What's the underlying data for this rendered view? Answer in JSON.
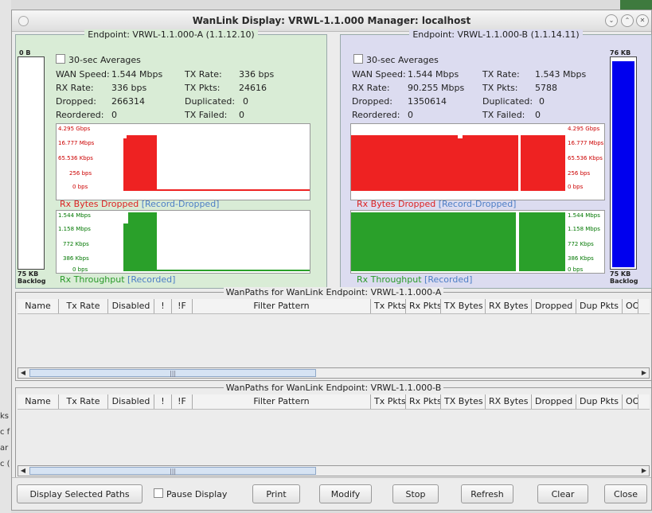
{
  "window": {
    "title": "WanLink Display: VRWL-1.1.000  Manager: localhost"
  },
  "backdrop": {
    "side_labels": [
      "ks",
      "c f",
      "ar",
      "c ("
    ]
  },
  "endpoint_a": {
    "legend": "Endpoint: VRWL-1.1.000-A  (1.1.12.10)",
    "backlog_top": "0 B",
    "backlog_bottom": "75 KB",
    "backlog_caption": "Backlog",
    "backlog_fill_fraction": 0,
    "averages_label": "30-sec Averages",
    "wan_speed_label": "WAN Speed:",
    "wan_speed_value": "1.544 Mbps",
    "tx_rate_label": "TX Rate:",
    "tx_rate_value": "336 bps",
    "rx_rate_label": "RX Rate:",
    "rx_rate_value": "336 bps",
    "tx_pkts_label": "TX Pkts:",
    "tx_pkts_value": "24616",
    "dropped_label": "Dropped:",
    "dropped_value": "266314",
    "duplicated_label": "Duplicated:",
    "duplicated_value": "0",
    "reordered_label": "Reordered:",
    "reordered_value": "0",
    "tx_failed_label": "TX Failed:",
    "tx_failed_value": "0",
    "drop_chart": {
      "title": "Rx Bytes Dropped",
      "subtitle": "[Record-Dropped]",
      "ticks": [
        "4.295 Gbps",
        "16.777 Mbps",
        "65.536 Kbps",
        "256 bps",
        "0 bps"
      ],
      "color": "#ee2222"
    },
    "thru_chart": {
      "title": "Rx Throughput",
      "subtitle": "[Recorded]",
      "ticks": [
        "1.544 Mbps",
        "1.158 Mbps",
        "772 Kbps",
        "386 Kbps",
        "0 bps"
      ],
      "color": "#2aa02a"
    }
  },
  "endpoint_b": {
    "legend": "Endpoint: VRWL-1.1.000-B  (1.1.14.11)",
    "backlog_top": "76 KB",
    "backlog_bottom": "75 KB",
    "backlog_caption": "Backlog",
    "backlog_fill_fraction": 0.99,
    "averages_label": "30-sec Averages",
    "wan_speed_label": "WAN Speed:",
    "wan_speed_value": "1.544 Mbps",
    "tx_rate_label": "TX Rate:",
    "tx_rate_value": "1.543 Mbps",
    "rx_rate_label": "RX Rate:",
    "rx_rate_value": "90.255 Mbps",
    "tx_pkts_label": "TX Pkts:",
    "tx_pkts_value": "5788",
    "dropped_label": "Dropped:",
    "dropped_value": "1350614",
    "duplicated_label": "Duplicated:",
    "duplicated_value": "0",
    "reordered_label": "Reordered:",
    "reordered_value": "0",
    "tx_failed_label": "TX Failed:",
    "tx_failed_value": "0",
    "drop_chart": {
      "title": "Rx Bytes Dropped",
      "subtitle": "[Record-Dropped]",
      "ticks": [
        "4.295 Gbps",
        "16.777 Mbps",
        "65.536 Kbps",
        "256 bps",
        "0 bps"
      ],
      "color": "#ee2222"
    },
    "thru_chart": {
      "title": "Rx Throughput",
      "subtitle": "[Recorded]",
      "ticks": [
        "1.544 Mbps",
        "1.158 Mbps",
        "772 Kbps",
        "386 Kbps",
        "0 bps"
      ],
      "color": "#2aa02a"
    }
  },
  "paths_a": {
    "legend": "WanPaths for WanLink Endpoint: VRWL-1.1.000-A"
  },
  "paths_b": {
    "legend": "WanPaths for WanLink Endpoint: VRWL-1.1.000-B"
  },
  "columns": [
    "Name",
    "Tx Rate",
    "Disabled",
    "!",
    "!F",
    "Filter Pattern",
    "Tx Pkts",
    "Rx Pkts",
    "TX Bytes",
    "RX Bytes",
    "Dropped",
    "Dup Pkts",
    "OO"
  ],
  "footer": {
    "display_selected": "Display Selected Paths",
    "pause_display": "Pause Display",
    "print": "Print",
    "modify": "Modify",
    "stop": "Stop",
    "refresh": "Refresh",
    "clear": "Clear",
    "close": "Close"
  }
}
